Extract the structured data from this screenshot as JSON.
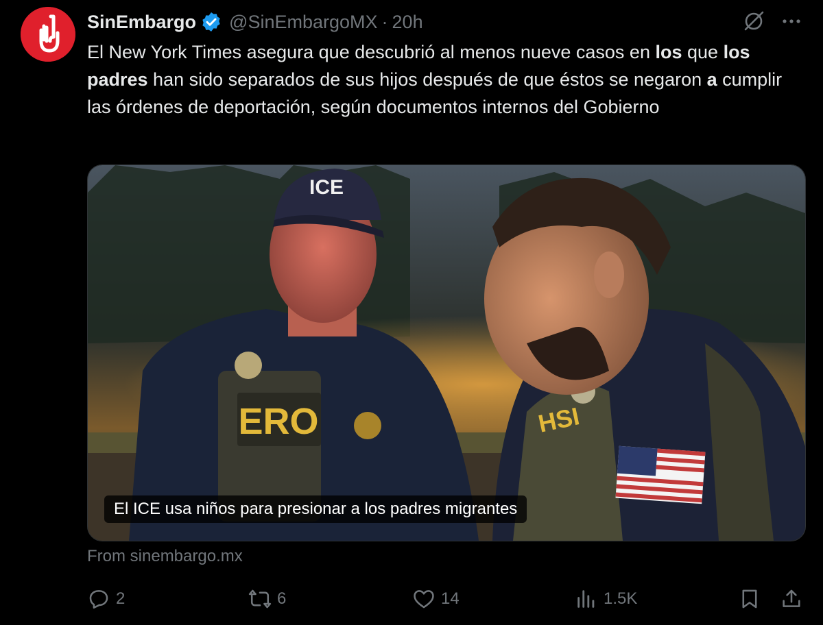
{
  "account": {
    "name": "SinEmbargo",
    "handle": "@SinEmbargoMX",
    "separator": "·",
    "time": "20h"
  },
  "tweet": {
    "segments": [
      {
        "text": "El New York Times asegura que descubrió al menos nueve casos en ",
        "bold": false
      },
      {
        "text": "los",
        "bold": true
      },
      {
        "text": " que ",
        "bold": false
      },
      {
        "text": "los padres",
        "bold": true
      },
      {
        "text": " han sido separados de sus hijos después de que éstos se negaron ",
        "bold": false
      },
      {
        "text": "a",
        "bold": true
      },
      {
        "text": " cumplir las órdenes de deportación, según documentos internos del Gobierno",
        "bold": false
      }
    ]
  },
  "media": {
    "caption": "El ICE usa niños para presionar a los padres migrantes",
    "cap_text": "ICE",
    "vest_left": "ERO",
    "vest_right": "HSI"
  },
  "source": "From sinembargo.mx",
  "actions": {
    "replies": "2",
    "reposts": "6",
    "likes": "14",
    "views": "1.5K"
  },
  "colors": {
    "background": "#000000",
    "text": "#e7e9ea",
    "muted": "#71767b",
    "verified": "#1d9bf0",
    "avatar": "#e0202c"
  },
  "icons": [
    "hand-logo-icon",
    "verified-badge-icon",
    "grok-icon",
    "more-icon",
    "reply-icon",
    "repost-icon",
    "like-icon",
    "views-icon",
    "bookmark-icon",
    "share-icon"
  ]
}
